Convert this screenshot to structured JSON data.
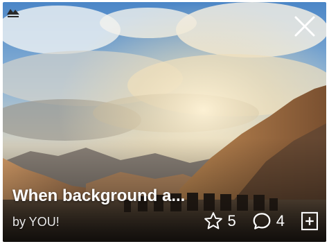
{
  "card": {
    "title": "When background a...",
    "byline": "by YOU!",
    "image_subject": "mountain-desert-camel-caravan-photo"
  },
  "actions": {
    "star_count": "5",
    "comment_count": "4"
  },
  "icons": {
    "close": "close-icon",
    "star": "star-icon",
    "comment": "comment-icon",
    "add": "add-to-collection-icon",
    "logo": "site-logo-icon"
  },
  "colors": {
    "text": "#ffffff",
    "byline": "#e8e8e8"
  }
}
